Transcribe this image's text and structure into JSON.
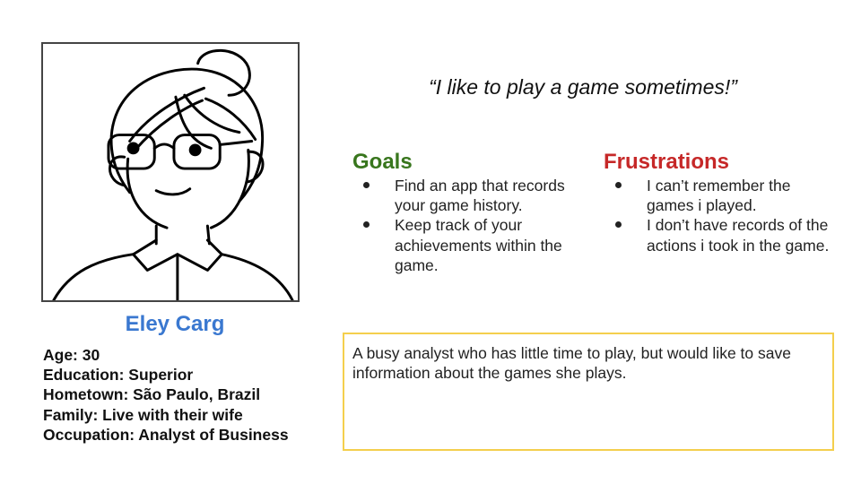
{
  "persona": {
    "name": "Eley Carg",
    "avatar_icon": "woman-with-glasses-illustration-icon",
    "demographics": [
      "Age: 30",
      "Education: Superior",
      "Hometown: São Paulo, Brazil",
      "Family: Live with their wife",
      "Occupation: Analyst of Business"
    ]
  },
  "quote": "“I like to play a game sometimes!”",
  "goals": {
    "heading": "Goals",
    "items": [
      "Find an app that records your game history.",
      "Keep track of your achievements within the game."
    ]
  },
  "frustrations": {
    "heading": "Frustrations",
    "items": [
      "I can’t remember the games i played.",
      "I don’t have records of the actions i took in the game."
    ]
  },
  "bio": "A busy analyst who has little time to play, but would like to save information about the games she plays.",
  "colors": {
    "name": "#3a78d0",
    "goals": "#38761d",
    "frustrations": "#c62828",
    "bio_border": "#f4cf4d",
    "portrait_border": "#444444"
  }
}
